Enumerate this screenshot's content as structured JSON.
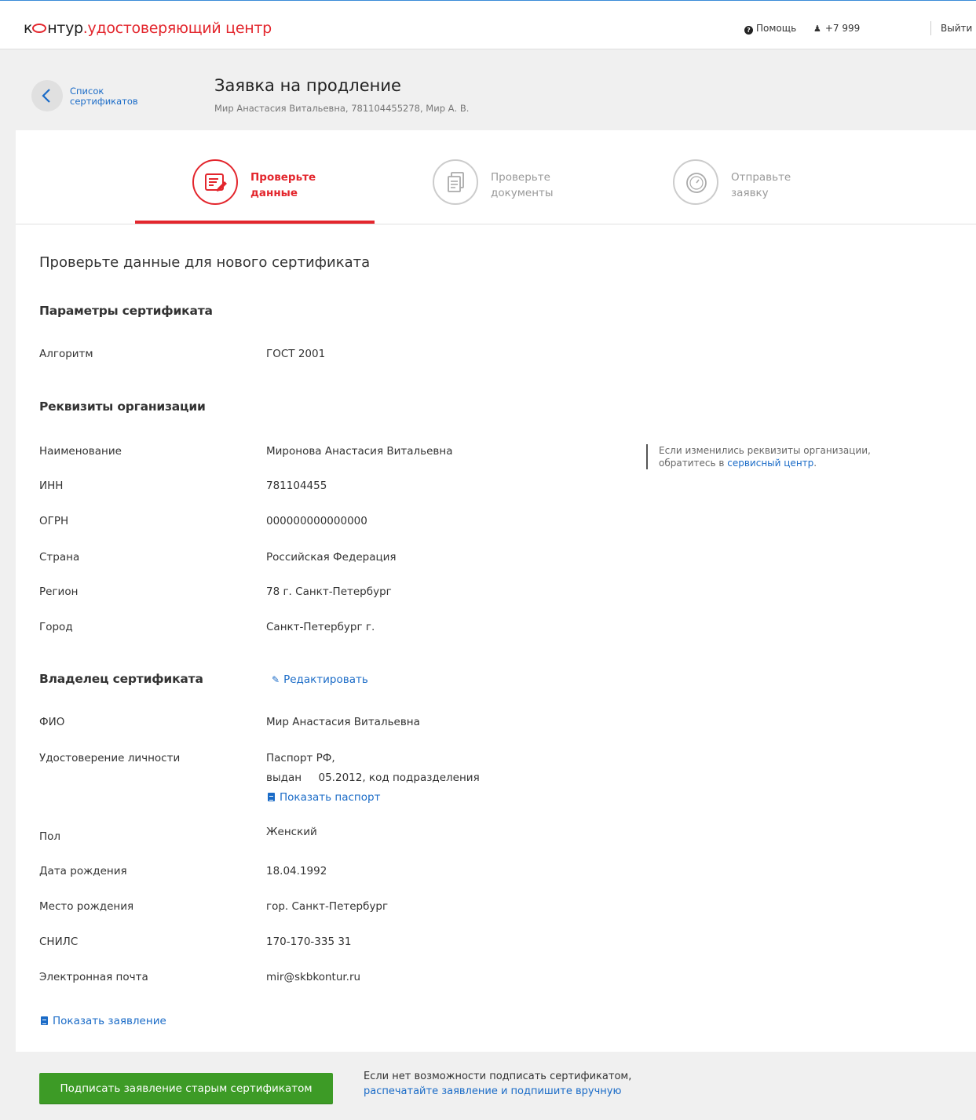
{
  "header": {
    "logo_prefix": "к",
    "logo_suffix": "нтур",
    "logo_product": ".удостоверяющий центр",
    "help_label": "Помощь",
    "phone": "+7 999",
    "logout_label": "Выйти"
  },
  "titlebar": {
    "back_label": "Список сертификатов",
    "title": "Заявка на продление",
    "subtitle": "Мир Анастасия Витальевна, 781104455278, Мир А. В."
  },
  "steps": [
    {
      "label_line1": "Проверьте",
      "label_line2": "данные",
      "active": true
    },
    {
      "label_line1": "Проверьте",
      "label_line2": "документы",
      "active": false
    },
    {
      "label_line1": "Отправьте",
      "label_line2": "заявку",
      "active": false
    }
  ],
  "content": {
    "heading": "Проверьте данные для нового сертификата",
    "cert_params": {
      "heading": "Параметры сертификата",
      "rows": [
        {
          "label": "Алгоритм",
          "value": "ГОСТ 2001"
        }
      ]
    },
    "org": {
      "heading": "Реквизиты организации",
      "rows": [
        {
          "label": "Наименование",
          "value": "Миронова Анастасия Витальевна"
        },
        {
          "label": "ИНН",
          "value": "781104455"
        },
        {
          "label": "ОГРН",
          "value": "000000000000000"
        },
        {
          "label": "Страна",
          "value": "Российская Федерация"
        },
        {
          "label": "Регион",
          "value": "78 г. Санкт-Петербург"
        },
        {
          "label": "Город",
          "value": "Санкт-Петербург г."
        }
      ],
      "note_text": "Если изменились реквизиты организации, обратитесь в",
      "note_link": "сервисный центр",
      "note_end": "."
    },
    "owner": {
      "heading": "Владелец сертификата",
      "edit_label": "Редактировать",
      "fio_label": "ФИО",
      "fio_value": "Мир Анастасия Витальевна",
      "id_label": "Удостоверение личности",
      "id_value_line1": "Паспорт РФ,",
      "id_value_line2": "выдан     05.2012, код подразделения",
      "show_passport": "Показать паспорт",
      "rows": [
        {
          "label": "Пол",
          "value": "Женский"
        },
        {
          "label": "Дата рождения",
          "value": "18.04.1992"
        },
        {
          "label": "Место рождения",
          "value": "гор. Санкт-Петербург"
        },
        {
          "label": "СНИЛС",
          "value": "170-170-335 31"
        },
        {
          "label": "Электронная почта",
          "value": "mir@skbkontur.ru"
        }
      ]
    },
    "show_application": "Показать заявление"
  },
  "footer": {
    "sign_button": "Подписать заявление старым сертификатом",
    "text_line1": "Если нет возможности подписать сертификатом,",
    "text_link": "распечатайте заявление и подпишите вручную"
  },
  "colors": {
    "brand_red": "#e3262d",
    "link_blue": "#1a6bc7",
    "button_green": "#3d9b26"
  }
}
